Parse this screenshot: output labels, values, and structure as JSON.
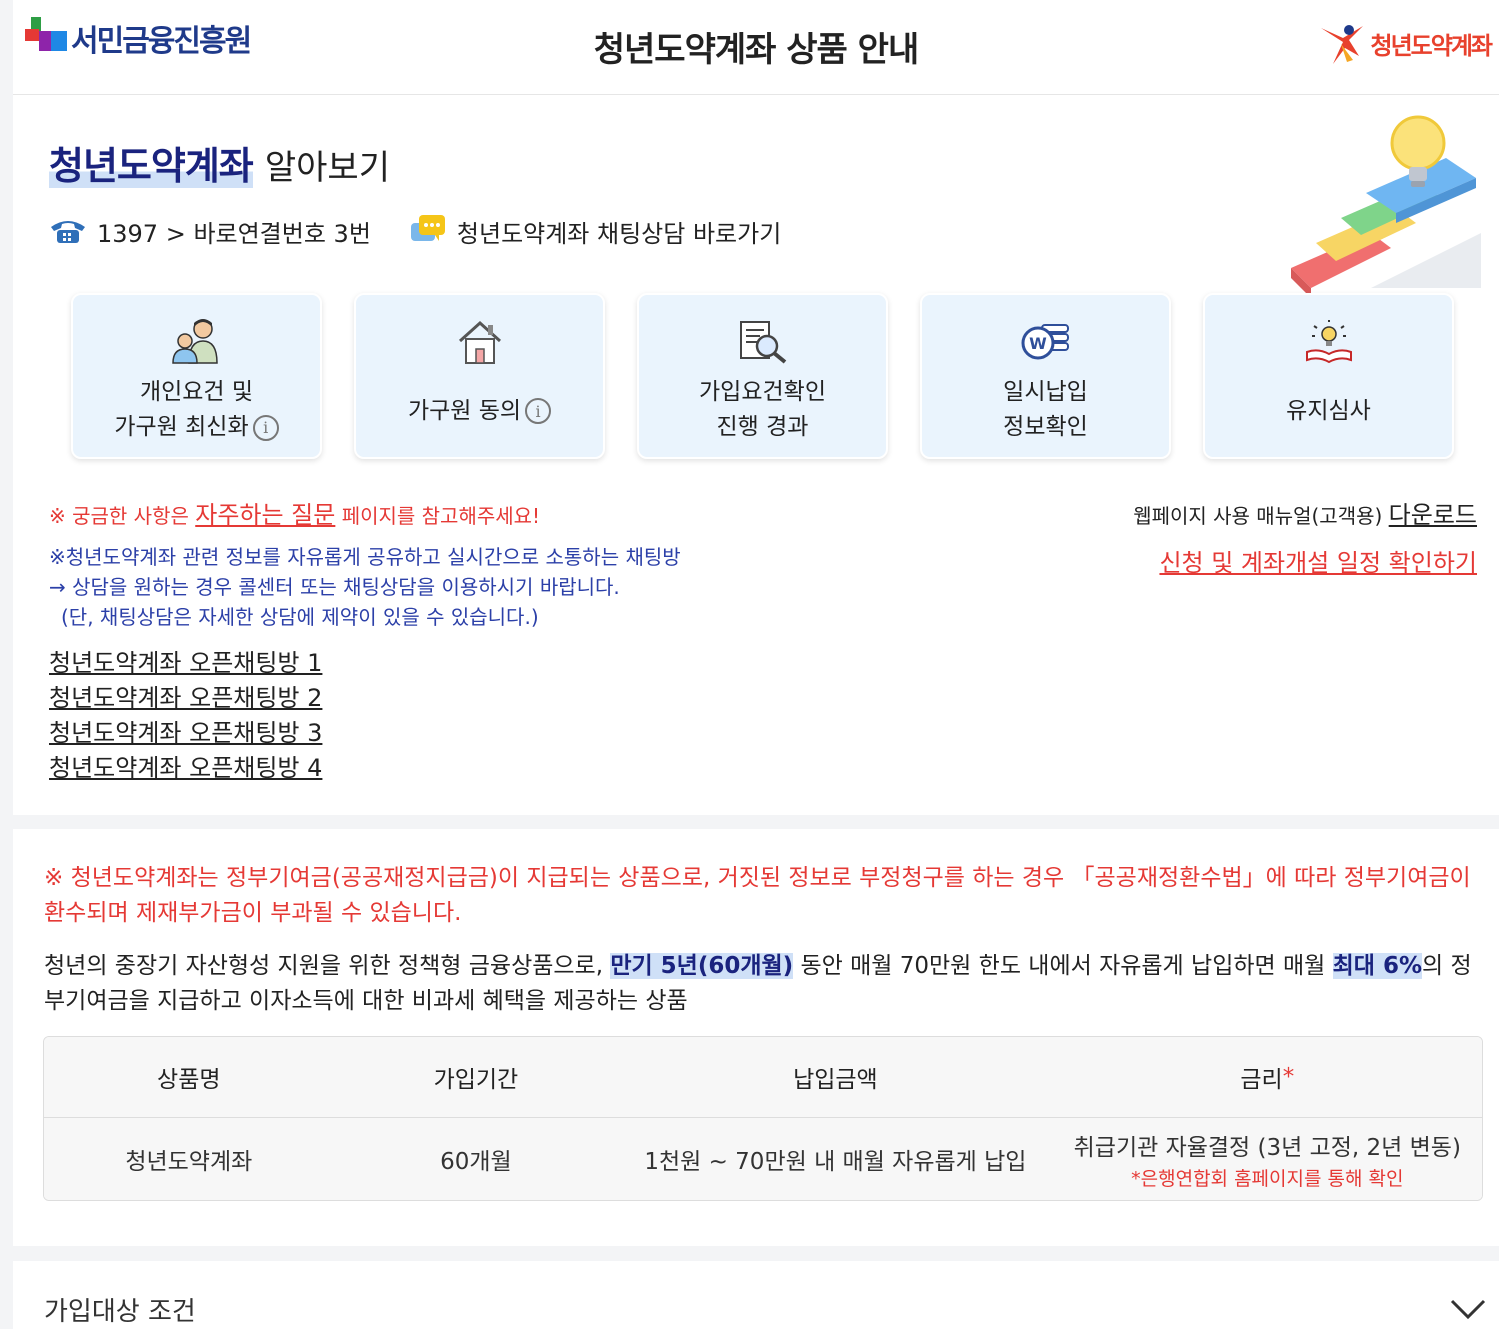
{
  "header": {
    "left_logo_text": "서민금융진흥원",
    "title": "청년도약계좌 상품 안내",
    "right_logo_text": "청년도약계좌"
  },
  "intro": {
    "title_highlight": "청년도약계좌",
    "title_rest": "알아보기",
    "phone_text": "1397 > 바로연결번호 3번",
    "chat_link": "청년도약계좌 채팅상담 바로가기"
  },
  "cards": [
    {
      "line1": "개인요건 및",
      "line2": "가구원 최신화",
      "info": true,
      "icon": "family-icon"
    },
    {
      "line1": "가구원 동의",
      "line2": "",
      "info": true,
      "icon": "house-icon"
    },
    {
      "line1": "가입요건확인",
      "line2": "진행 경과",
      "info": false,
      "icon": "document-search-icon"
    },
    {
      "line1": "일시납입",
      "line2": "정보확인",
      "info": false,
      "icon": "coin-stack-icon"
    },
    {
      "line1": "유지심사",
      "line2": "",
      "info": false,
      "icon": "lightbulb-book-icon"
    }
  ],
  "notices": {
    "faq_prefix": "※ 궁금한 사항은 ",
    "faq_link": "자주하는 질문",
    "faq_suffix": " 페이지를 참고해주세요!",
    "manual_prefix": "웹페이지 사용 매뉴얼(고객용) ",
    "manual_link": "다운로드",
    "schedule_link": "신청 및 계좌개설 일정 확인하기",
    "chat_line1": "※청년도약계좌 관련 정보를 자유롭게 공유하고 실시간으로 소통하는 채팅방",
    "chat_line2": "→ 상담을 원하는 경우 콜센터 또는 채팅상담을 이용하시기 바랍니다.",
    "chat_line3": "(단, 채팅상담은 자세한 상담에 제약이 있을 수 있습니다.)"
  },
  "open_chats": [
    "청년도약계좌 오픈채팅방 1",
    "청년도약계좌 오픈채팅방 2",
    "청년도약계좌 오픈채팅방 3",
    "청년도약계좌 오픈채팅방 4"
  ],
  "product": {
    "warning": "※ 청년도약계좌는 정부기여금(공공재정지급금)이 지급되는 상품으로, 거짓된 정보로 부정청구를 하는 경우 「공공재정환수법」에 따라 정부기여금이 환수되며 제재부가금이 부과될 수 있습니다.",
    "desc_part1": "청년의 중장기 자산형성 지원을 위한 정책형 금융상품으로, ",
    "desc_hl1": "만기 5년(60개월)",
    "desc_part2": " 동안 매월 70만원 한도 내에서 자유롭게 납입하면 매월 ",
    "desc_hl2": "최대 6%",
    "desc_part3": "의 정부기여금을 지급하고 이자소득에 대한 비과세 혜택을 제공하는 상품",
    "table": {
      "headers": [
        "상품명",
        "가입기간",
        "납입금액",
        "금리"
      ],
      "required_mark": "*",
      "row": [
        "청년도약계좌",
        "60개월",
        "1천원 ~ 70만원 내 매월 자유롭게 납입",
        "취급기관 자율결정 (3년 고정, 2년 변동)"
      ],
      "rate_note": "*은행연합회 홈페이지를 통해 확인"
    }
  },
  "accordion": {
    "title": "가입대상 조건"
  },
  "colors": {
    "accent_red": "#e53935",
    "navy": "#1a237e",
    "highlight": "#cfe0f7",
    "card_bg": "#eaf4fd",
    "chat_note": "#2c40a8"
  }
}
